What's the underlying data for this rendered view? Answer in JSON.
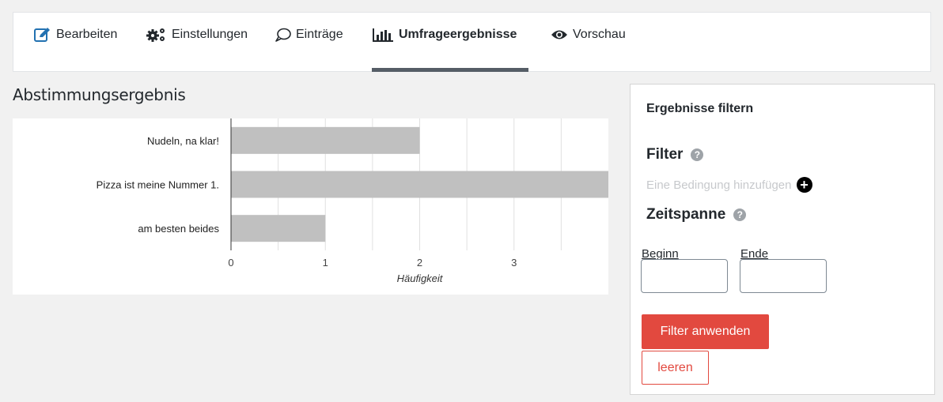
{
  "tabs": [
    {
      "label": "Bearbeiten",
      "icon": "edit-icon",
      "active": false
    },
    {
      "label": "Einstellungen",
      "icon": "gears-icon",
      "active": false
    },
    {
      "label": "Einträge",
      "icon": "speech-bubble-icon",
      "active": false
    },
    {
      "label": "Umfrageergebnisse",
      "icon": "bar-chart-icon",
      "active": true
    },
    {
      "label": "Vorschau",
      "icon": "eye-icon",
      "active": false
    }
  ],
  "results": {
    "title": "Abstimmungsergebnis"
  },
  "chart_data": {
    "type": "bar",
    "orientation": "horizontal",
    "categories": [
      "Nudeln, na klar!",
      "Pizza ist meine Nummer 1.",
      "am besten beides"
    ],
    "values": [
      2,
      4,
      1
    ],
    "xlabel": "Häufigkeit",
    "ylabel": "",
    "xlim": [
      0,
      4
    ],
    "xticks": [
      0,
      1,
      2,
      3
    ],
    "grid": true,
    "bar_color": "#c0c0c0"
  },
  "filter": {
    "heading": "Ergebnisse filtern",
    "filter_label": "Filter",
    "help_glyph": "?",
    "add_condition": "Eine Bedingung hinzufügen",
    "add_glyph": "+",
    "timespan_label": "Zeitspanne",
    "start_label": "Beginn",
    "end_label": "Ende",
    "start_value": "",
    "end_value": "",
    "apply_button": "Filter anwenden",
    "clear_button": "leeren",
    "accent_color": "#e2493f"
  }
}
